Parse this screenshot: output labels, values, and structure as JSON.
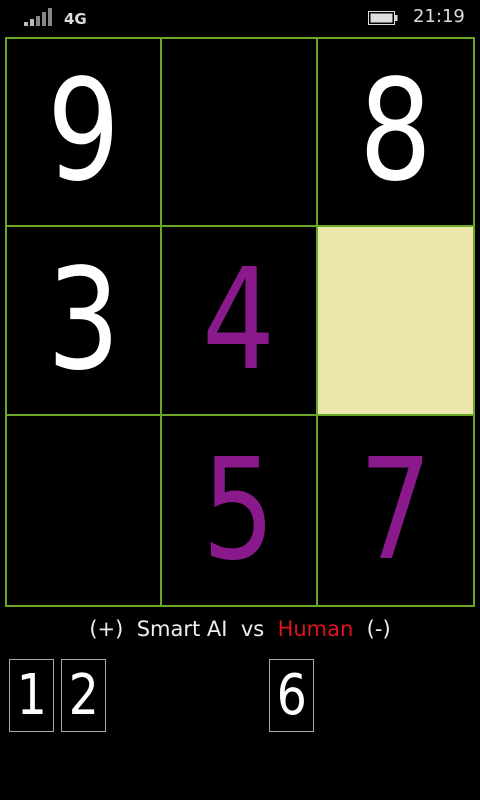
{
  "status_bar": {
    "network": "4G",
    "time": "21:19",
    "signal_icon": "signal-strength-icon",
    "battery_icon": "battery-icon"
  },
  "board": {
    "cells": [
      {
        "value": "9",
        "color": "#ffffff",
        "highlighted": false
      },
      {
        "value": "",
        "color": "#ffffff",
        "highlighted": false
      },
      {
        "value": "8",
        "color": "#ffffff",
        "highlighted": false
      },
      {
        "value": "3",
        "color": "#ffffff",
        "highlighted": false
      },
      {
        "value": "4",
        "color": "#8a1a8b",
        "highlighted": false
      },
      {
        "value": "",
        "color": "#ffffff",
        "highlighted": true
      },
      {
        "value": "",
        "color": "#ffffff",
        "highlighted": false
      },
      {
        "value": "5",
        "color": "#8a1a8b",
        "highlighted": false
      },
      {
        "value": "7",
        "color": "#8a1a8b",
        "highlighted": false
      }
    ],
    "grid_color": "#6aa628",
    "highlight_color": "#ede6ab"
  },
  "players": {
    "left_sign": "(+)",
    "ai_name": "Smart AI",
    "vs": "vs",
    "human_name": "Human",
    "right_sign": "(-)",
    "human_color": "#e0141e"
  },
  "tiles": [
    "1",
    "2",
    "6"
  ]
}
